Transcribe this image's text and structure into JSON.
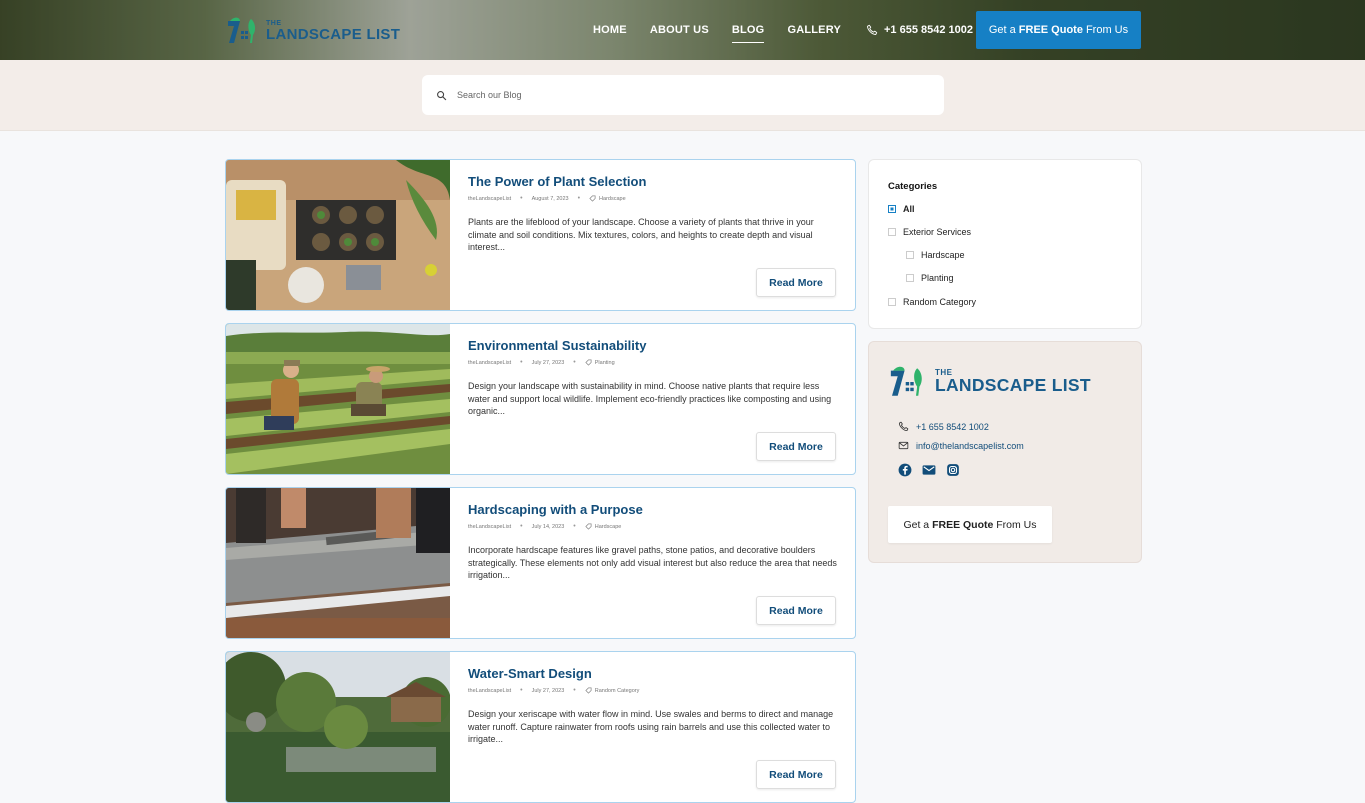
{
  "brand": {
    "the": "THE",
    "name": "LANDSCAPE LIST"
  },
  "nav": {
    "items": [
      "HOME",
      "ABOUT US",
      "BLOG",
      "GALLERY"
    ],
    "active": "BLOG",
    "phone": "+1 655 8542 1002",
    "cta": {
      "pre": "Get a",
      "bold": "FREE Quote",
      "post": "From Us"
    }
  },
  "search": {
    "placeholder": "Search our Blog"
  },
  "posts": [
    {
      "title": "The Power of Plant Selection",
      "author": "theLandscapeList",
      "date": "August 7, 2023",
      "category": "Hardscape",
      "excerpt": "Plants are the lifeblood of your landscape. Choose a variety of plants that thrive in your climate and soil conditions. Mix textures, colors, and heights to create depth and visual interest...",
      "button": "Read More"
    },
    {
      "title": "Environmental Sustainability",
      "author": "theLandscapeList",
      "date": "July 27, 2023",
      "category": "Planting",
      "excerpt": "Design your landscape with sustainability in mind. Choose native plants that require less water and support local wildlife. Implement eco-friendly practices like composting and using organic...",
      "button": "Read More"
    },
    {
      "title": "Hardscaping with a Purpose",
      "author": "theLandscapeList",
      "date": "July 14, 2023",
      "category": "Hardscape",
      "excerpt": "Incorporate hardscape features like gravel paths, stone patios, and decorative boulders strategically. These elements not only add visual interest but also reduce the area that needs irrigation...",
      "button": "Read More"
    },
    {
      "title": "Water-Smart Design",
      "author": "theLandscapeList",
      "date": "July 27, 2023",
      "category": "Random Category",
      "excerpt": "Design your xeriscape with water flow in mind. Use swales and berms to direct and manage water runoff. Capture rainwater from roofs using rain barrels and use this collected water to irrigate...",
      "button": "Read More"
    }
  ],
  "sidebar": {
    "categories_title": "Categories",
    "categories": [
      {
        "label": "All",
        "checked": true
      },
      {
        "label": "Exterior Services",
        "checked": false
      },
      {
        "label": "Hardscape",
        "checked": false
      },
      {
        "label": "Planting",
        "checked": false
      },
      {
        "label": "Random Category",
        "checked": false
      }
    ],
    "contact": {
      "phone": "+1 655 8542 1002",
      "email": "info@thelandscapelist.com",
      "socials": [
        "facebook-icon",
        "mail-icon",
        "instagram-icon"
      ],
      "cta": {
        "pre": "Get a",
        "bold": "FREE Quote",
        "post": "From Us"
      }
    }
  },
  "colors": {
    "accent": "#1680c5",
    "brand": "#124d7a",
    "band": "#f3ede9"
  }
}
